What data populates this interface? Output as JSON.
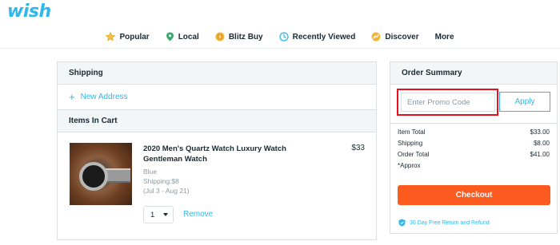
{
  "brand": {
    "logo_text": "wish"
  },
  "nav": {
    "items": [
      {
        "label": "Popular",
        "icon": "star-icon"
      },
      {
        "label": "Local",
        "icon": "location-pin-icon"
      },
      {
        "label": "Blitz Buy",
        "icon": "blitz-coin-icon"
      },
      {
        "label": "Recently Viewed",
        "icon": "clock-icon"
      },
      {
        "label": "Discover",
        "icon": "discover-icon"
      },
      {
        "label": "More",
        "icon": ""
      }
    ]
  },
  "shipping": {
    "heading": "Shipping",
    "new_address_label": "New Address"
  },
  "cart": {
    "heading": "Items In Cart",
    "items": [
      {
        "title": "2020 Men's Quartz Watch Luxury Watch Gentleman Watch",
        "price": "$33",
        "color": "Blue",
        "shipping": "Shipping:$8",
        "delivery": "(Jul 3 - Aug 21)",
        "quantity": "1",
        "remove_label": "Remove"
      }
    ]
  },
  "summary": {
    "heading": "Order Summary",
    "promo_placeholder": "Enter Promo Code",
    "apply_label": "Apply",
    "rows": [
      {
        "label": "Item Total",
        "value": "$33.00"
      },
      {
        "label": "Shipping",
        "value": "$8.00"
      },
      {
        "label": "Order Total",
        "value": "$41.00"
      },
      {
        "label": "*Approx",
        "value": ""
      }
    ],
    "checkout_label": "Checkout",
    "refund_label": "30 Day Free Return and Refund"
  },
  "colors": {
    "brand_blue": "#2fb7ec",
    "checkout_orange": "#fc5a1f",
    "highlight_red": "#e8101c"
  }
}
